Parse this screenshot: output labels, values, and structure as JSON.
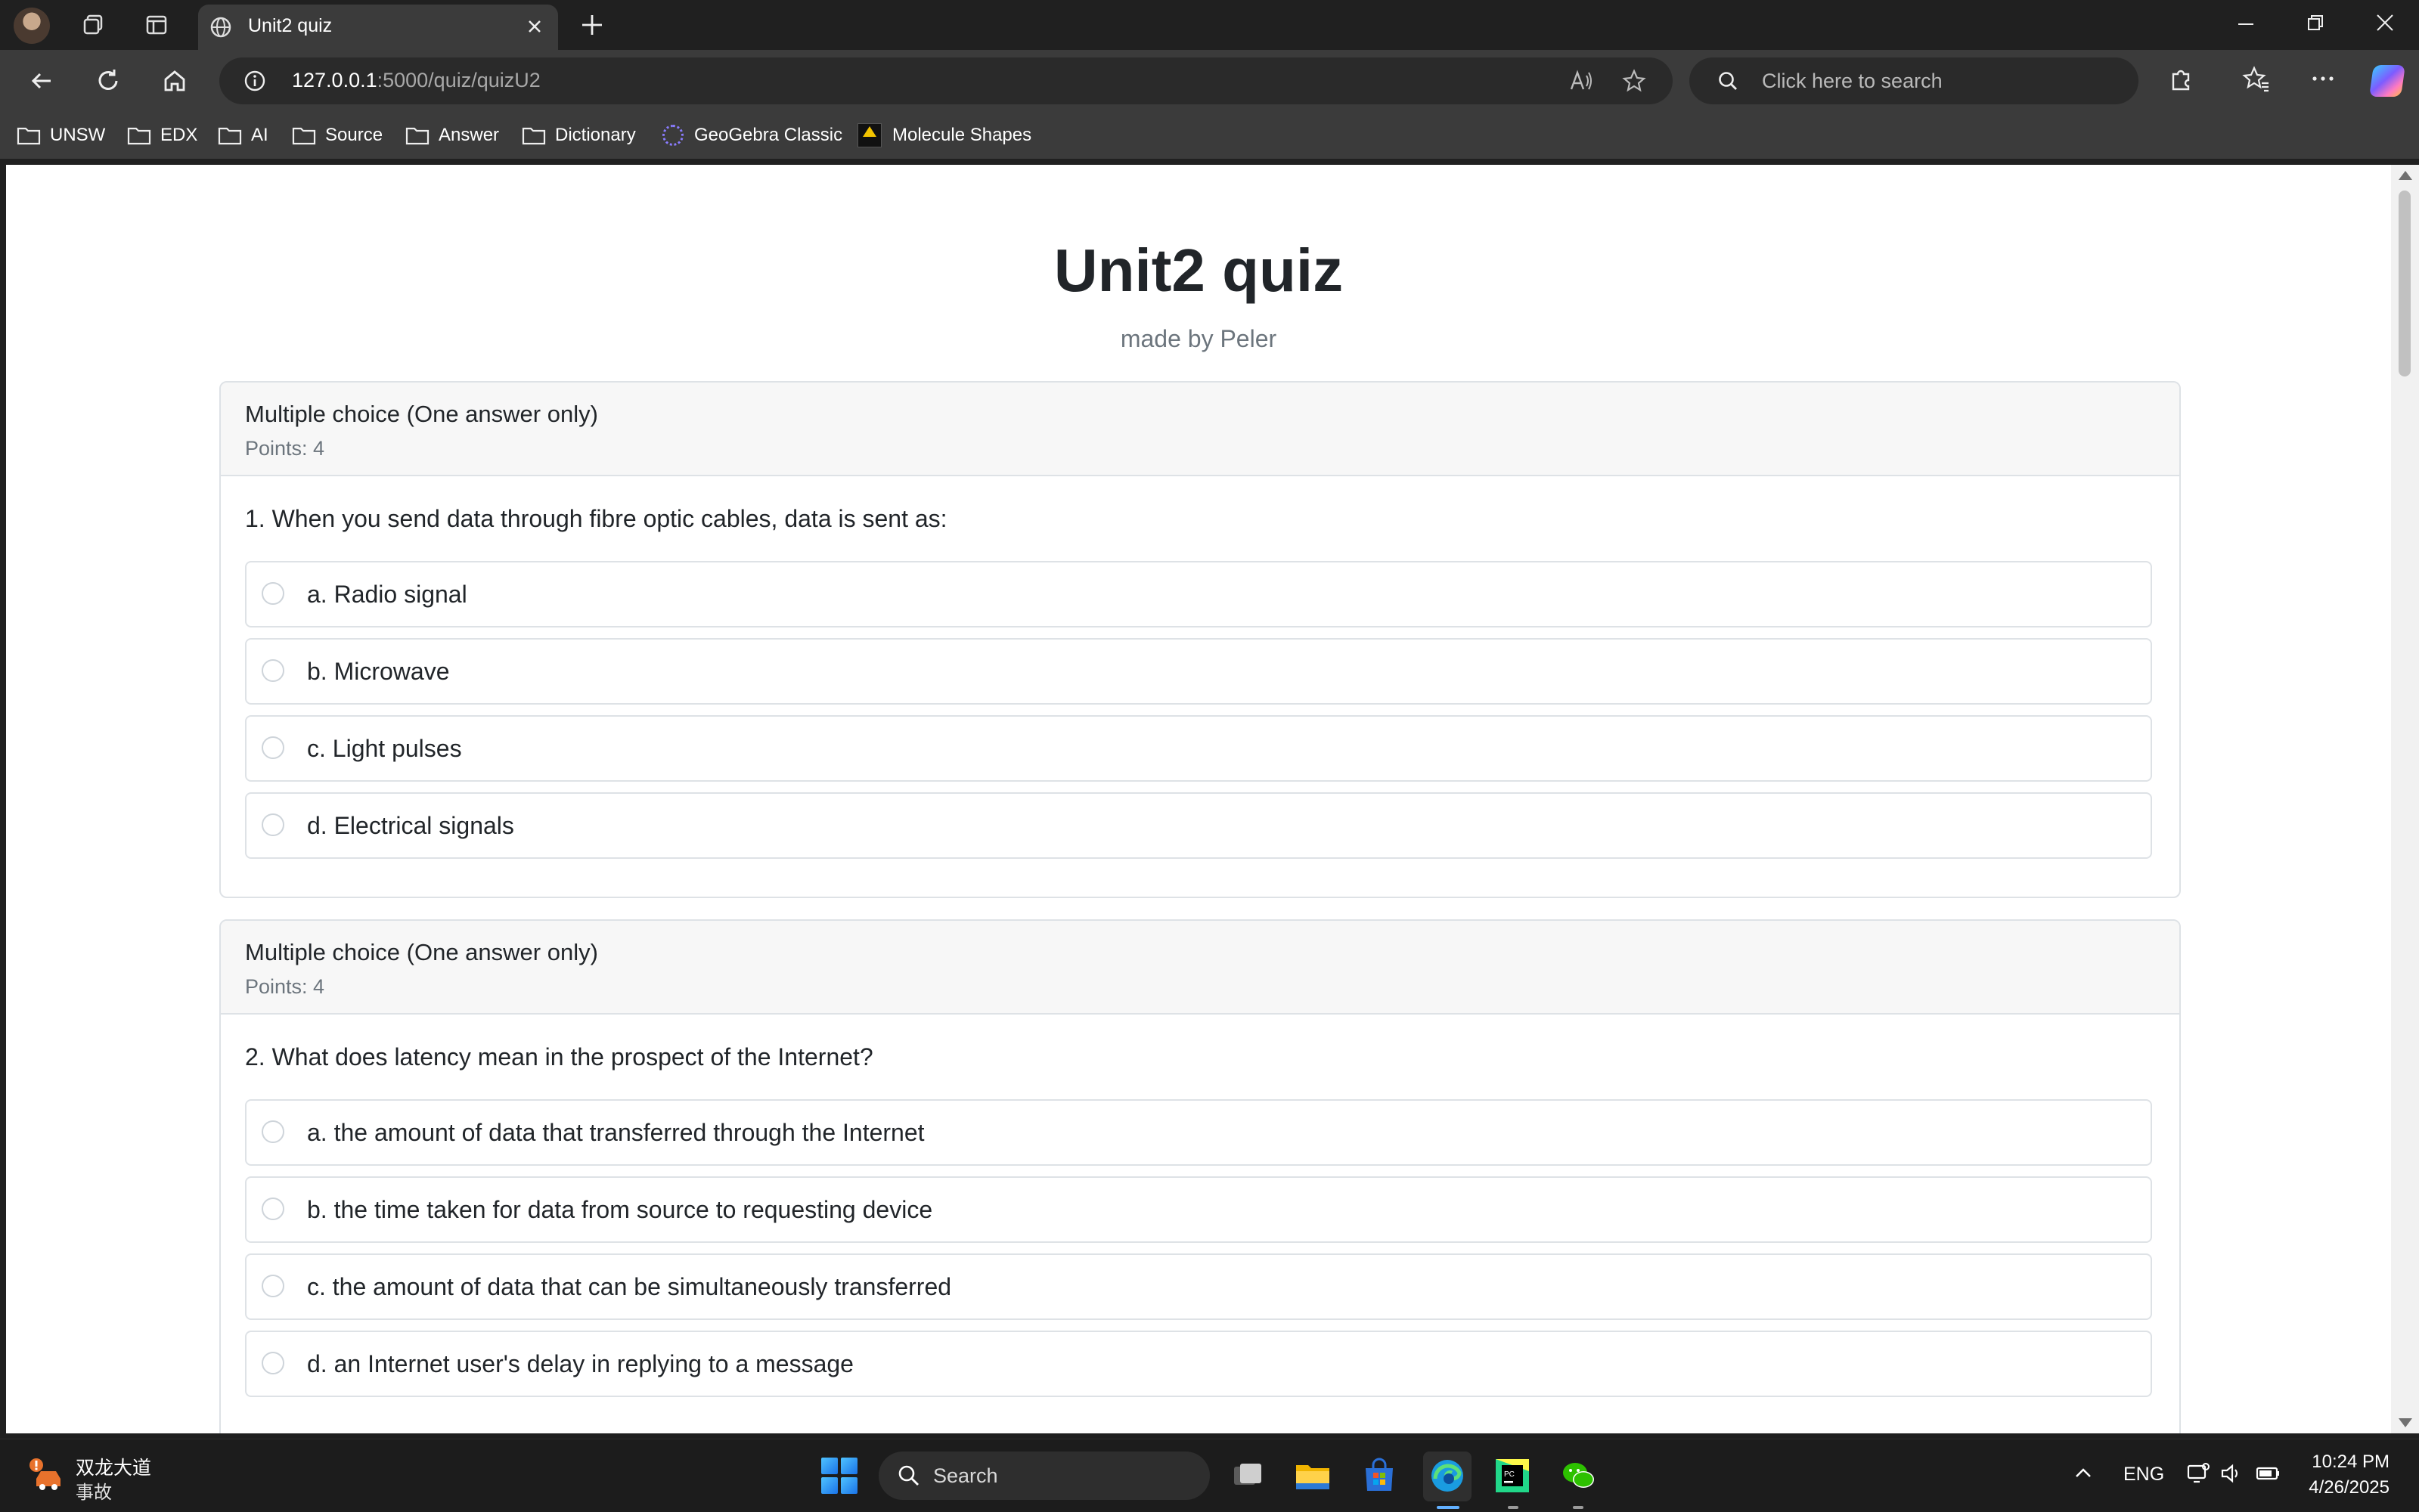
{
  "browser": {
    "tab_title": "Unit2 quiz",
    "url_host": "127.0.0.1",
    "url_path": ":5000/quiz/quizU2",
    "search_placeholder": "Click here to search"
  },
  "bookmarks": [
    {
      "label": "UNSW",
      "icon": "folder-icon"
    },
    {
      "label": "EDX",
      "icon": "folder-icon"
    },
    {
      "label": "AI",
      "icon": "folder-icon"
    },
    {
      "label": "Source",
      "icon": "folder-icon"
    },
    {
      "label": "Answer",
      "icon": "folder-icon"
    },
    {
      "label": "Dictionary",
      "icon": "folder-icon"
    },
    {
      "label": "GeoGebra Classic",
      "icon": "geogebra-icon"
    },
    {
      "label": "Molecule Shapes",
      "icon": "phet-icon"
    }
  ],
  "page": {
    "title": "Unit2 quiz",
    "subtitle": "made by Peler"
  },
  "questions": [
    {
      "type": "Multiple choice (One answer only)",
      "points": "Points: 4",
      "text": "1. When you send data through fibre optic cables, data is sent as:",
      "options": [
        "a. Radio signal",
        "b. Microwave",
        "c. Light pulses",
        "d. Electrical signals"
      ]
    },
    {
      "type": "Multiple choice (One answer only)",
      "points": "Points: 4",
      "text": "2. What does latency mean in the prospect of the Internet?",
      "options": [
        "a. the amount of data that transferred through the Internet",
        "b. the time taken for data from source to requesting device",
        "c. the amount of data that can be simultaneously transferred",
        "d. an Internet user's delay in replying to a message"
      ]
    }
  ],
  "taskbar": {
    "weather_title": "双龙大道",
    "weather_sub": "事故",
    "search_label": "Search",
    "language": "ENG",
    "time": "10:24 PM",
    "date": "4/26/2025"
  },
  "colors": {
    "chrome_dark": "#202020",
    "chrome_toolbar": "#3b3b3b",
    "page_bg": "#ffffff",
    "card_header_bg": "#f7f7f7",
    "border": "#dee2e6",
    "muted_text": "#6c757d"
  }
}
